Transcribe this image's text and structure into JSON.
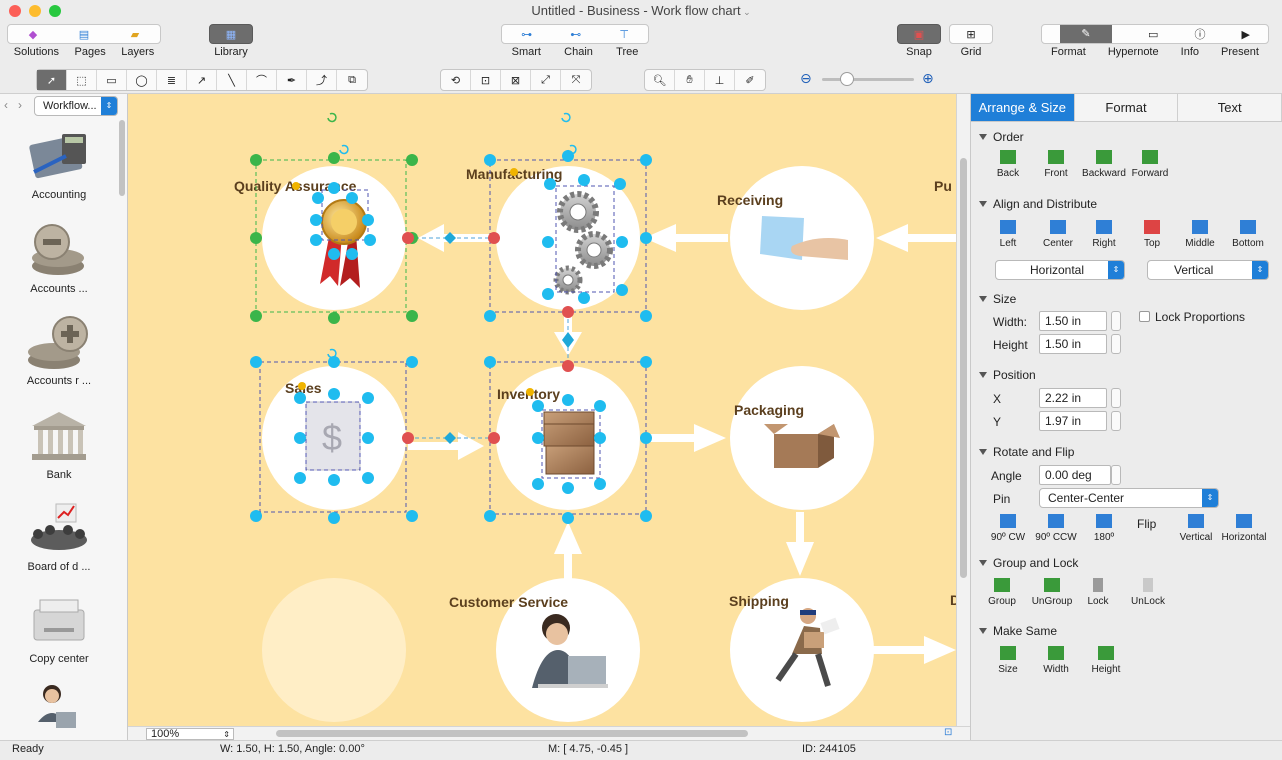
{
  "window": {
    "title": "Untitled - Business - Work flow chart"
  },
  "toolbar": {
    "solutions": "Solutions",
    "pages": "Pages",
    "layers": "Layers",
    "library": "Library",
    "smart": "Smart",
    "chain": "Chain",
    "tree": "Tree",
    "snap": "Snap",
    "grid": "Grid",
    "format": "Format",
    "hypernote": "Hypernote",
    "info": "Info",
    "present": "Present"
  },
  "sidebar": {
    "library_select": "Workflow...",
    "items": [
      "Accounting",
      "Accounts  ...",
      "Accounts r ...",
      "Bank",
      "Board of d ...",
      "Copy center"
    ]
  },
  "canvas": {
    "nodes": {
      "quality": "Quality Assurance",
      "manufacturing": "Manufacturing",
      "receiving": "Receiving",
      "purchasing": "Pu",
      "sales": "Sales",
      "inventory": "Inventory",
      "packaging": "Packaging",
      "customer_service": "Customer Service",
      "shipping": "Shipping",
      "cut_off": "D"
    },
    "zoom": "100%"
  },
  "panel": {
    "tabs": [
      "Arrange & Size",
      "Format",
      "Text"
    ],
    "order": {
      "title": "Order",
      "buttons": [
        "Back",
        "Front",
        "Backward",
        "Forward"
      ]
    },
    "align": {
      "title": "Align and Distribute",
      "buttons": [
        "Left",
        "Center",
        "Right",
        "Top",
        "Middle",
        "Bottom"
      ],
      "horizontal": "Horizontal",
      "vertical": "Vertical"
    },
    "size": {
      "title": "Size",
      "width_label": "Width:",
      "width": "1.50 in",
      "height_label": "Height",
      "height": "1.50 in",
      "lock": "Lock Proportions"
    },
    "position": {
      "title": "Position",
      "x_label": "X",
      "x": "2.22 in",
      "y_label": "Y",
      "y": "1.97 in"
    },
    "rotate": {
      "title": "Rotate and Flip",
      "angle_label": "Angle",
      "angle": "0.00 deg",
      "pin_label": "Pin",
      "pin": "Center-Center",
      "buttons": [
        "90º CW",
        "90º CCW",
        "180º"
      ],
      "flip_label": "Flip",
      "flip_buttons": [
        "Vertical",
        "Horizontal"
      ]
    },
    "group": {
      "title": "Group and Lock",
      "buttons": [
        "Group",
        "UnGroup",
        "Lock",
        "UnLock"
      ]
    },
    "same": {
      "title": "Make Same",
      "buttons": [
        "Size",
        "Width",
        "Height"
      ]
    }
  },
  "status": {
    "ready": "Ready",
    "dims": "W: 1.50,  H: 1.50,  Angle: 0.00°",
    "mouse": "M: [ 4.75, -0.45 ]",
    "id": "ID: 244105"
  }
}
